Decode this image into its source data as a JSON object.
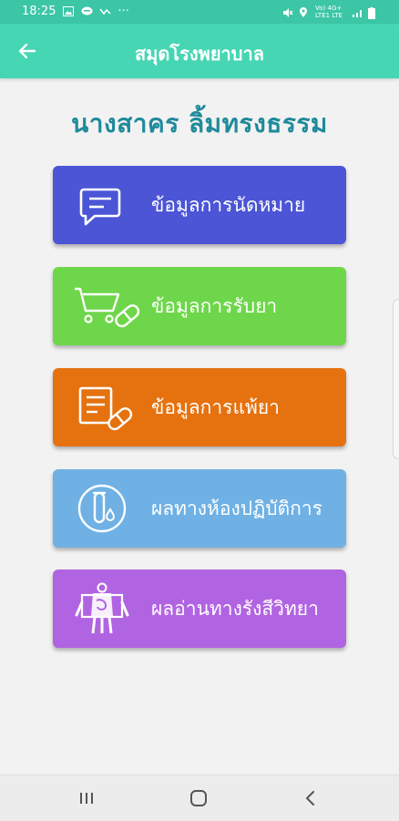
{
  "status_bar": {
    "time": "18:25",
    "dots": "···",
    "network_labels": "Vo) 4G+ LTE1 LTE",
    "left_icons": [
      "image-icon",
      "line-chat-icon",
      "missed-call-icon"
    ],
    "right_icons": [
      "mute-icon",
      "location-icon",
      "wifi-icon",
      "signal-icon",
      "battery-icon"
    ]
  },
  "app_bar": {
    "title": "สมุดโรงพยาบาล",
    "back_icon": "arrow-left-icon"
  },
  "patient": {
    "name": "นางสาคร ลิ้มทรงธรรม"
  },
  "menu": {
    "items": [
      {
        "label": "ข้อมูลการนัดหมาย",
        "color": "#4b55d6",
        "icon": "message-icon"
      },
      {
        "label": "ข้อมูลการรับยา",
        "color": "#6ed64a",
        "icon": "cart-pill-icon"
      },
      {
        "label": "ข้อมูลการแพ้ยา",
        "color": "#e6720f",
        "icon": "document-pill-icon"
      },
      {
        "label": "ผลทางห้องปฏิบัติการ",
        "color": "#6fb1e4",
        "icon": "test-tube-icon"
      },
      {
        "label": "ผลอ่านทางรังสีวิทยา",
        "color": "#b164e2",
        "icon": "xray-body-icon"
      }
    ]
  },
  "nav_bar": {
    "items": [
      "recents-icon",
      "home-icon",
      "back-icon"
    ]
  },
  "colors": {
    "status_bar": "#3cc6a6",
    "app_bar": "#46d6b3",
    "name_text": "#1f8a9a",
    "background": "#f2f2f2"
  }
}
